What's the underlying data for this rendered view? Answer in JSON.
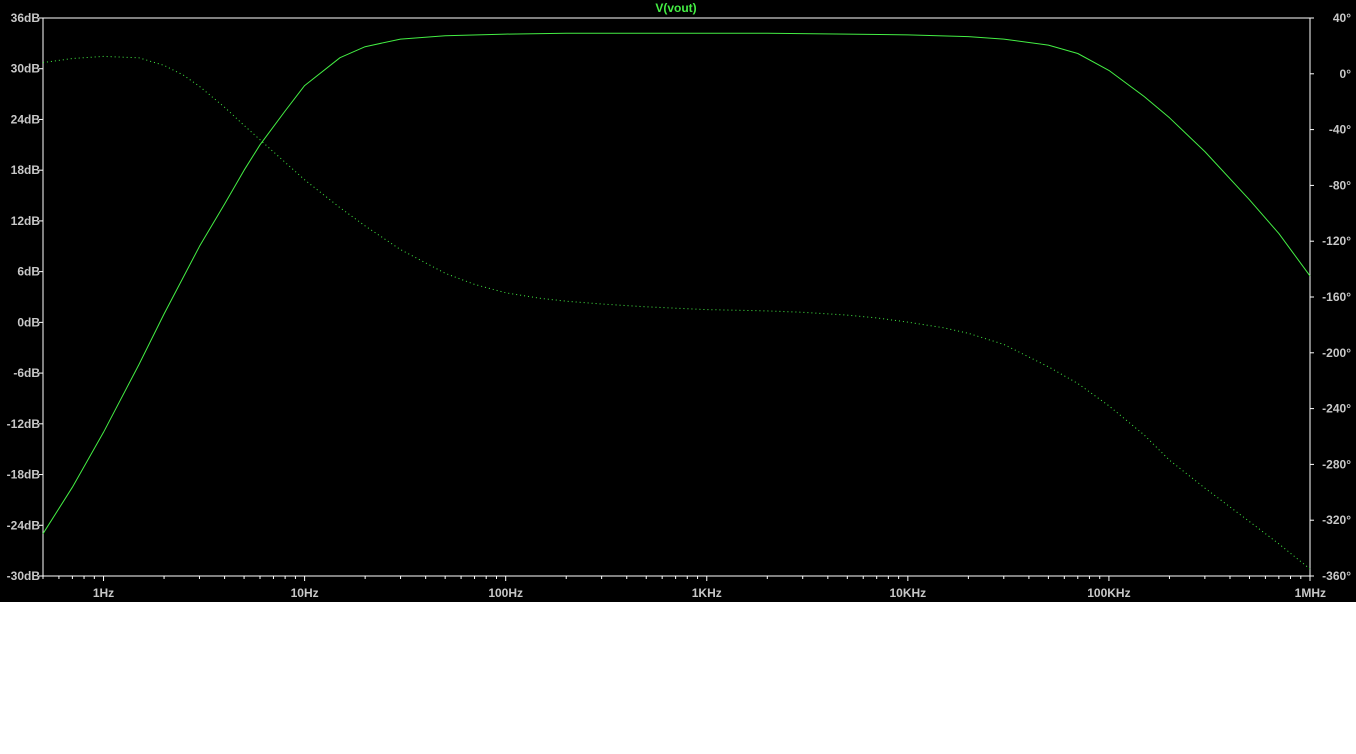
{
  "chart_data": {
    "type": "line",
    "title": "V(vout)",
    "xscale": "log",
    "xlim": [
      0.5,
      1000000
    ],
    "xticks": [
      {
        "value": 1,
        "label": "1Hz"
      },
      {
        "value": 10,
        "label": "10Hz"
      },
      {
        "value": 100,
        "label": "100Hz"
      },
      {
        "value": 1000,
        "label": "1KHz"
      },
      {
        "value": 10000,
        "label": "10KHz"
      },
      {
        "value": 100000,
        "label": "100KHz"
      },
      {
        "value": 1000000,
        "label": "1MHz"
      }
    ],
    "ylim_left": [
      -30,
      36
    ],
    "yticks_left": [
      {
        "value": 36,
        "label": "36dB"
      },
      {
        "value": 30,
        "label": "30dB"
      },
      {
        "value": 24,
        "label": "24dB"
      },
      {
        "value": 18,
        "label": "18dB"
      },
      {
        "value": 12,
        "label": "12dB"
      },
      {
        "value": 6,
        "label": "6dB"
      },
      {
        "value": 0,
        "label": "0dB"
      },
      {
        "value": -6,
        "label": "-6dB"
      },
      {
        "value": -12,
        "label": "-12dB"
      },
      {
        "value": -18,
        "label": "-18dB"
      },
      {
        "value": -24,
        "label": "-24dB"
      },
      {
        "value": -30,
        "label": "-30dB"
      }
    ],
    "ylim_right": [
      -360,
      40
    ],
    "yticks_right": [
      {
        "value": 40,
        "label": "40°"
      },
      {
        "value": 0,
        "label": "0°"
      },
      {
        "value": -40,
        "label": "-40°"
      },
      {
        "value": -80,
        "label": "-80°"
      },
      {
        "value": -120,
        "label": "-120°"
      },
      {
        "value": -160,
        "label": "-160°"
      },
      {
        "value": -200,
        "label": "-200°"
      },
      {
        "value": -240,
        "label": "-240°"
      },
      {
        "value": -280,
        "label": "-280°"
      },
      {
        "value": -320,
        "label": "-320°"
      },
      {
        "value": -360,
        "label": "-360°"
      }
    ],
    "grid": false,
    "series": [
      {
        "axis": "left",
        "style": "solid",
        "color": "#44ee44",
        "x": [
          0.5,
          0.7,
          1,
          1.5,
          2,
          3,
          4,
          5,
          6,
          8,
          10,
          15,
          20,
          30,
          50,
          100,
          200,
          500,
          1000,
          2000,
          5000,
          10000,
          20000,
          30000,
          50000,
          70000,
          100000,
          150000,
          200000,
          300000,
          500000,
          700000,
          1000000
        ],
        "values": [
          -25,
          -19.5,
          -13,
          -5,
          1,
          9,
          14,
          18,
          21,
          25,
          28,
          31.3,
          32.6,
          33.5,
          33.9,
          34.1,
          34.2,
          34.2,
          34.2,
          34.2,
          34.1,
          34.0,
          33.8,
          33.5,
          32.8,
          31.8,
          29.8,
          26.7,
          24.2,
          20.2,
          14.5,
          10.5,
          5.5
        ]
      },
      {
        "axis": "right",
        "style": "dotted",
        "color": "#44ee44",
        "x": [
          0.5,
          0.7,
          1,
          1.5,
          2,
          2.5,
          3,
          4,
          5,
          7,
          10,
          15,
          20,
          30,
          50,
          70,
          100,
          150,
          200,
          300,
          500,
          700,
          1000,
          2000,
          3000,
          5000,
          7000,
          10000,
          15000,
          20000,
          30000,
          50000,
          70000,
          100000,
          150000,
          200000,
          300000,
          500000,
          700000,
          1000000
        ],
        "values": [
          8,
          11,
          12.5,
          11.5,
          6,
          -1,
          -9,
          -24,
          -37,
          -56,
          -76,
          -96,
          -109,
          -126,
          -143,
          -151,
          -157,
          -161,
          -163,
          -165,
          -167,
          -168,
          -169,
          -170,
          -171,
          -173,
          -175,
          -178,
          -182,
          -186,
          -194,
          -210,
          -222,
          -238,
          -259,
          -277,
          -297,
          -321,
          -337,
          -355
        ]
      }
    ]
  }
}
